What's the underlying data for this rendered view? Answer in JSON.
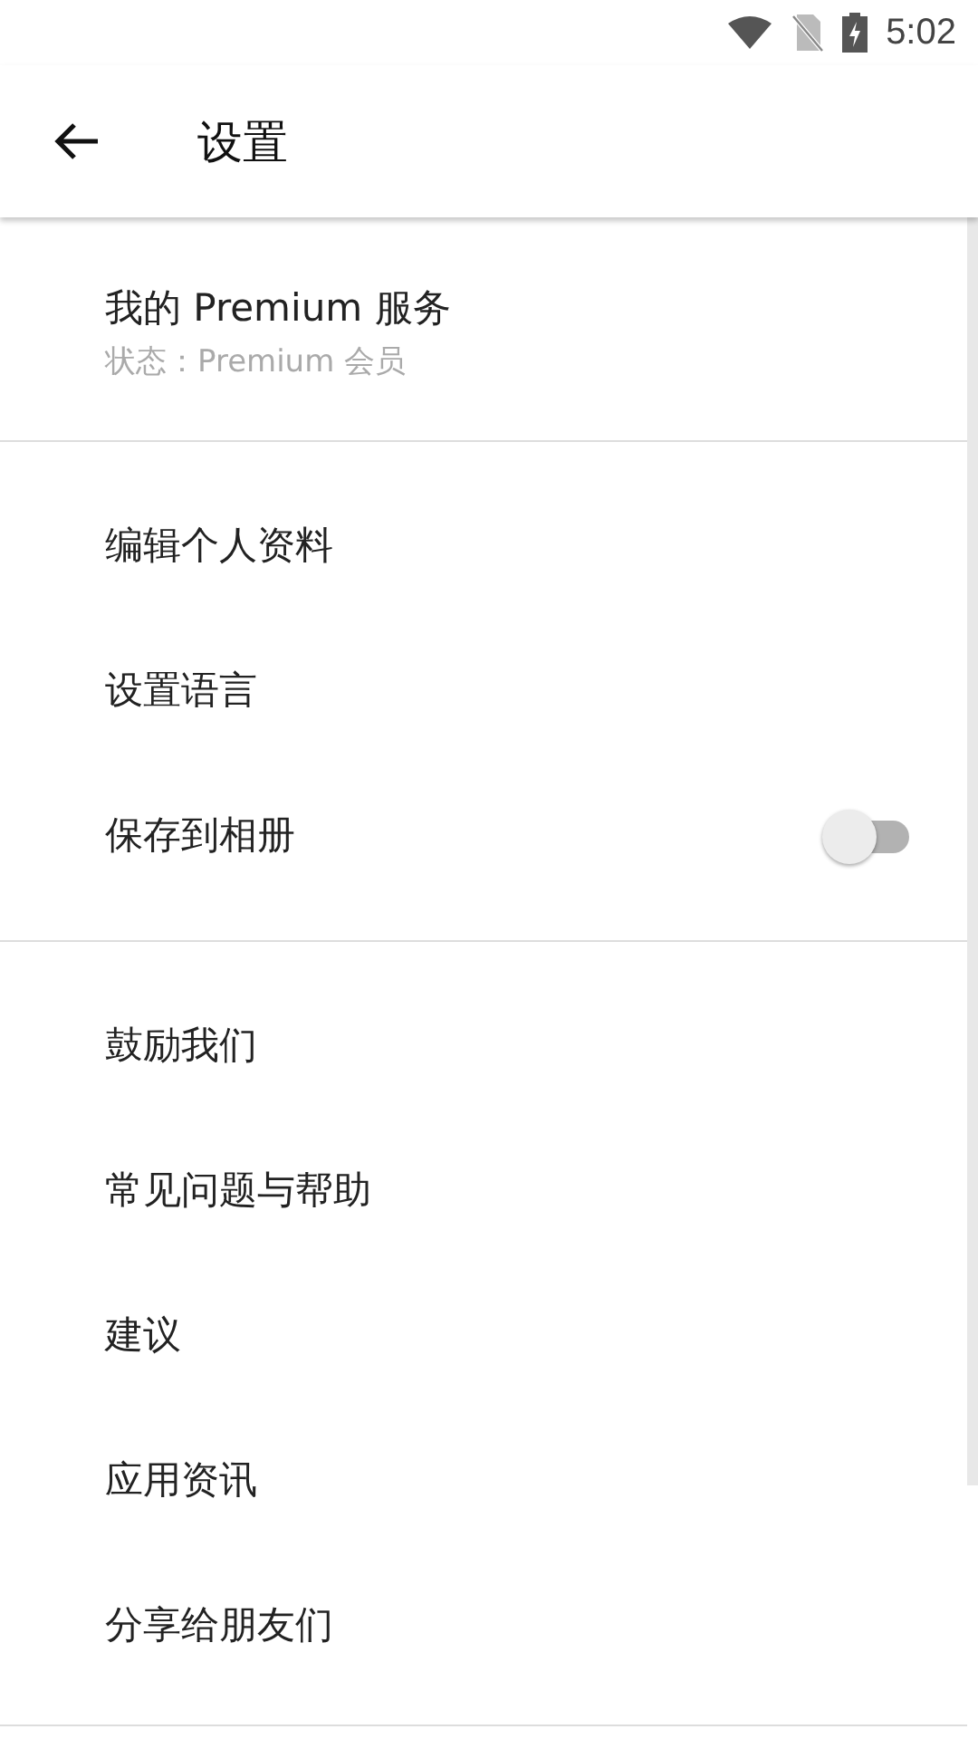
{
  "status_bar": {
    "time": "5:02"
  },
  "toolbar": {
    "title": "设置"
  },
  "sections": [
    {
      "items": [
        {
          "kind": "account",
          "label": "我的 Premium 服务",
          "subtitle": "状态：Premium 会员"
        }
      ]
    },
    {
      "items": [
        {
          "kind": "link",
          "label": "编辑个人资料"
        },
        {
          "kind": "link",
          "label": "设置语言"
        },
        {
          "kind": "toggle",
          "label": "保存到相册",
          "on": false
        }
      ]
    },
    {
      "items": [
        {
          "kind": "link",
          "label": "鼓励我们"
        },
        {
          "kind": "link",
          "label": "常见问题与帮助"
        },
        {
          "kind": "link",
          "label": "建议"
        },
        {
          "kind": "link",
          "label": "应用资讯"
        },
        {
          "kind": "link",
          "label": "分享给朋友们"
        }
      ]
    }
  ]
}
